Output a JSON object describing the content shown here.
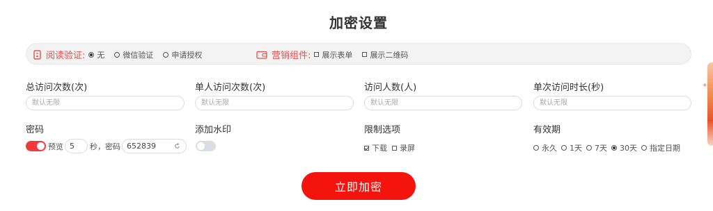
{
  "title": "加密设置",
  "verify": {
    "label": "阅读验证:",
    "options": [
      {
        "label": "无",
        "selected": true
      },
      {
        "label": "微信验证",
        "selected": false
      },
      {
        "label": "申请授权",
        "selected": false
      }
    ]
  },
  "marketing": {
    "label": "营销组件:",
    "options": [
      {
        "label": "展示表单",
        "checked": false
      },
      {
        "label": "展示二维码",
        "checked": false
      }
    ]
  },
  "fields": {
    "total_visits": {
      "label": "总访问次数(次)",
      "placeholder": "默认无限"
    },
    "single_visits": {
      "label": "单人访问次数(次)",
      "placeholder": "默认无限"
    },
    "visitors": {
      "label": "访问人数(人)",
      "placeholder": "默认无限"
    },
    "duration": {
      "label": "单次访问时长(秒)",
      "placeholder": "默认无限"
    }
  },
  "password": {
    "label": "密码",
    "enabled": true,
    "preview_label": "预览",
    "preview_seconds": "5",
    "seconds_text": "秒，密码",
    "code": "652839"
  },
  "watermark": {
    "label": "添加水印",
    "enabled": false
  },
  "restrict": {
    "label": "限制选项",
    "options": [
      {
        "label": "下载",
        "checked": true
      },
      {
        "label": "录屏",
        "checked": false
      }
    ]
  },
  "validity": {
    "label": "有效期",
    "options": [
      {
        "label": "永久",
        "selected": false
      },
      {
        "label": "1天",
        "selected": false
      },
      {
        "label": "7天",
        "selected": false
      },
      {
        "label": "30天",
        "selected": true
      },
      {
        "label": "指定日期",
        "selected": false
      }
    ]
  },
  "submit_label": "立即加密",
  "colors": {
    "accent": "#f5140d",
    "label_red": "#ef4a4a",
    "toggle_on": "#ef3b3b"
  }
}
